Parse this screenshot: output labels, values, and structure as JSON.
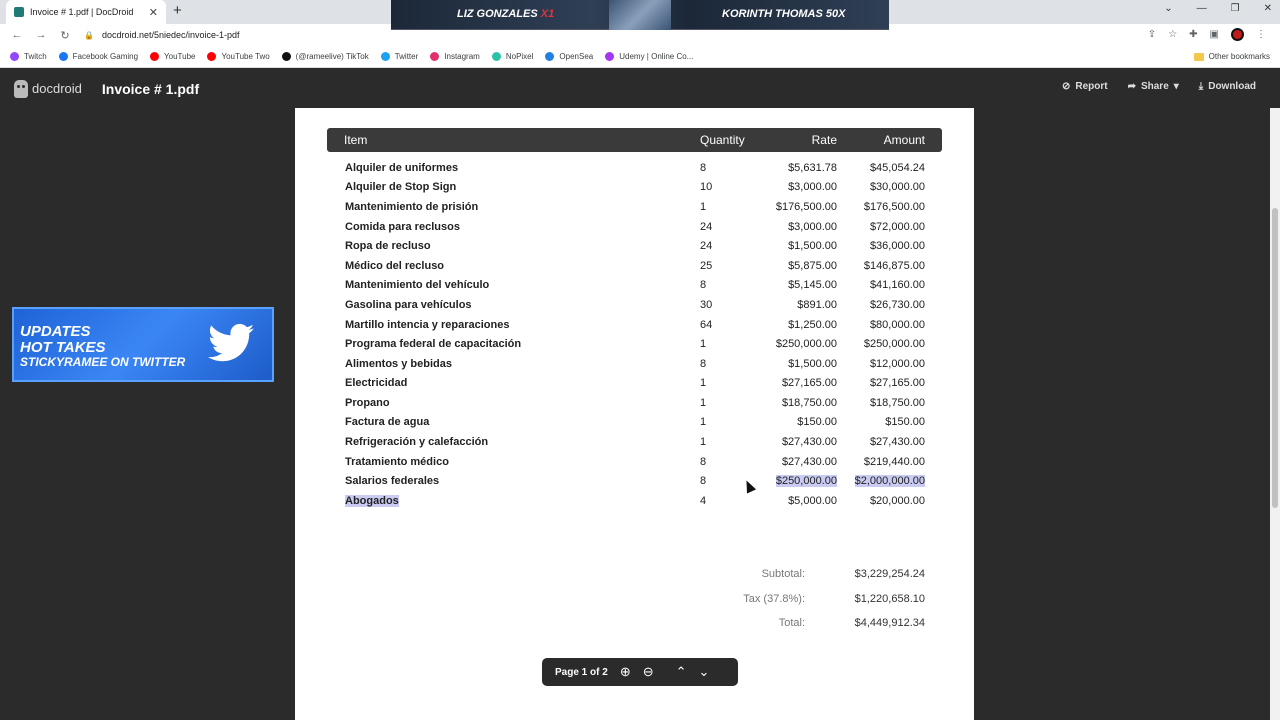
{
  "browser": {
    "tab_title": "Invoice # 1.pdf | DocDroid",
    "tab_close": "✕",
    "new_tab": "+",
    "url": "docdroid.net/5niedec/invoice-1-pdf",
    "window_controls": [
      "⌄",
      "—",
      "❐",
      "✕"
    ]
  },
  "overlay_banner": {
    "name_left": "LIZ GONZALES",
    "mult_left": "X1",
    "name_right": "KORINTH THOMAS 50X"
  },
  "bookmarks": [
    "Twitch",
    "Facebook Gaming",
    "YouTube",
    "YouTube Two",
    "(@rameelive) TikTok",
    "Twitter",
    "Instagram",
    "NoPixel",
    "OpenSea",
    "Udemy | Online Co..."
  ],
  "bookmark_colors": [
    "#9146ff",
    "#1877f2",
    "#ff0000",
    "#ff0000",
    "#111111",
    "#1da1f2",
    "#e1306c",
    "#2bc3a7",
    "#2081e2",
    "#a435f0"
  ],
  "other_bookmarks": "Other bookmarks",
  "app": {
    "brand": "docdroid",
    "doc_title": "Invoice # 1.pdf",
    "actions": {
      "report": "Report",
      "share": "Share",
      "download": "Download"
    }
  },
  "invoice": {
    "headers": {
      "item": "Item",
      "quantity": "Quantity",
      "rate": "Rate",
      "amount": "Amount"
    },
    "rows": [
      {
        "item": "Alquiler de uniformes",
        "qty": "8",
        "rate": "$5,631.78",
        "amount": "$45,054.24"
      },
      {
        "item": "Alquiler de Stop Sign",
        "qty": "10",
        "rate": "$3,000.00",
        "amount": "$30,000.00"
      },
      {
        "item": "Mantenimiento de prisión",
        "qty": "1",
        "rate": "$176,500.00",
        "amount": "$176,500.00"
      },
      {
        "item": "Comida para reclusos",
        "qty": "24",
        "rate": "$3,000.00",
        "amount": "$72,000.00"
      },
      {
        "item": "Ropa de recluso",
        "qty": "24",
        "rate": "$1,500.00",
        "amount": "$36,000.00"
      },
      {
        "item": "Médico del recluso",
        "qty": "25",
        "rate": "$5,875.00",
        "amount": "$146,875.00"
      },
      {
        "item": "Mantenimiento del vehículo",
        "qty": "8",
        "rate": "$5,145.00",
        "amount": "$41,160.00"
      },
      {
        "item": "Gasolina para vehículos",
        "qty": "30",
        "rate": "$891.00",
        "amount": "$26,730.00"
      },
      {
        "item": "Martillo intencia y reparaciones",
        "qty": "64",
        "rate": "$1,250.00",
        "amount": "$80,000.00"
      },
      {
        "item": "Programa federal de capacitación",
        "qty": "1",
        "rate": "$250,000.00",
        "amount": "$250,000.00"
      },
      {
        "item": "Alimentos y bebidas",
        "qty": "8",
        "rate": "$1,500.00",
        "amount": "$12,000.00"
      },
      {
        "item": "Electricidad",
        "qty": "1",
        "rate": "$27,165.00",
        "amount": "$27,165.00"
      },
      {
        "item": "Propano",
        "qty": "1",
        "rate": "$18,750.00",
        "amount": "$18,750.00"
      },
      {
        "item": "Factura de agua",
        "qty": "1",
        "rate": "$150.00",
        "amount": "$150.00"
      },
      {
        "item": "Refrigeración y calefacción",
        "qty": "1",
        "rate": "$27,430.00",
        "amount": "$27,430.00"
      },
      {
        "item": "Tratamiento médico",
        "qty": "8",
        "rate": "$27,430.00",
        "amount": "$219,440.00"
      },
      {
        "item": "Salarios federales",
        "qty": "8",
        "rate": "$250,000.00",
        "amount": "$2,000,000.00"
      },
      {
        "item": "Abogados",
        "qty": "4",
        "rate": "$5,000.00",
        "amount": "$20,000.00"
      }
    ],
    "subtotal_label": "Subtotal:",
    "subtotal": "$3,229,254.24",
    "tax_label": "Tax (37.8%):",
    "tax": "$1,220,658.10",
    "total_label": "Total:",
    "total": "$4,449,912.34"
  },
  "pager": {
    "label": "Page 1 of 2"
  },
  "promo": {
    "line1": "UPDATES",
    "line2": "HOT TAKES",
    "line3": "STICKYRAMEE ON TWITTER"
  }
}
